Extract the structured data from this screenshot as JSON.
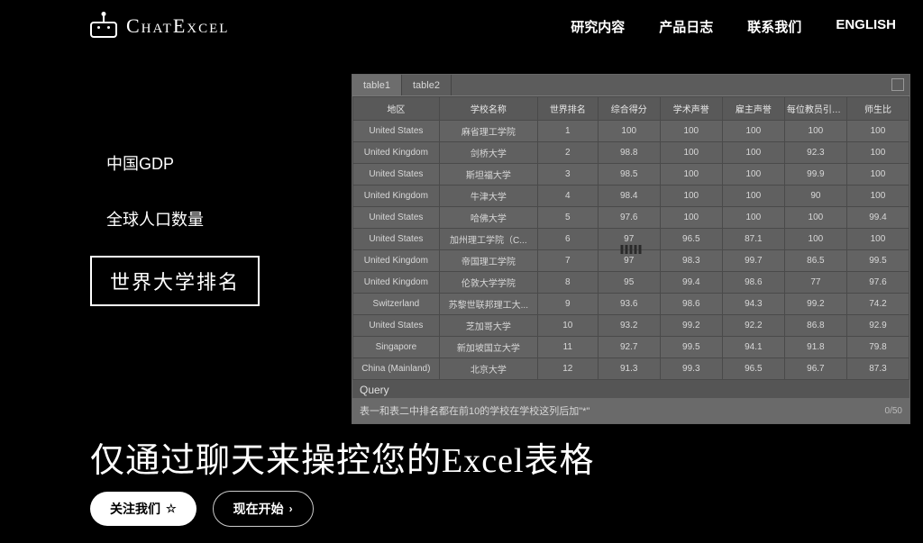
{
  "brand": "ChatExcel",
  "nav": {
    "research": "研究内容",
    "changelog": "产品日志",
    "contact": "联系我们",
    "lang": "ENGLISH"
  },
  "examples": {
    "items": [
      "中国GDP",
      "全球人口数量",
      "世界大学排名"
    ],
    "selected_index": 2
  },
  "panel": {
    "tabs": [
      "table1",
      "table2"
    ],
    "active_tab": 0,
    "expand_icon": "expand-icon",
    "columns": [
      "地区",
      "学校名称",
      "世界排名",
      "综合得分",
      "学术声誉",
      "雇主声誉",
      "每位教员引用率",
      "师生比"
    ],
    "rows": [
      [
        "United States",
        "麻省理工学院",
        "1",
        "100",
        "100",
        "100",
        "100",
        "100"
      ],
      [
        "United Kingdom",
        "剑桥大学",
        "2",
        "98.8",
        "100",
        "100",
        "92.3",
        "100"
      ],
      [
        "United States",
        "斯坦福大学",
        "3",
        "98.5",
        "100",
        "100",
        "99.9",
        "100"
      ],
      [
        "United Kingdom",
        "牛津大学",
        "4",
        "98.4",
        "100",
        "100",
        "90",
        "100"
      ],
      [
        "United States",
        "哈佛大学",
        "5",
        "97.6",
        "100",
        "100",
        "100",
        "99.4"
      ],
      [
        "United States",
        "加州理工学院（C...",
        "6",
        "97",
        "96.5",
        "87.1",
        "100",
        "100"
      ],
      [
        "United Kingdom",
        "帝国理工学院",
        "7",
        "97",
        "98.3",
        "99.7",
        "86.5",
        "99.5"
      ],
      [
        "United Kingdom",
        "伦敦大学学院",
        "8",
        "95",
        "99.4",
        "98.6",
        "77",
        "97.6"
      ],
      [
        "Switzerland",
        "苏黎世联邦理工大...",
        "9",
        "93.6",
        "98.6",
        "94.3",
        "99.2",
        "74.2"
      ],
      [
        "United States",
        "芝加哥大学",
        "10",
        "93.2",
        "99.2",
        "92.2",
        "86.8",
        "92.9"
      ],
      [
        "Singapore",
        "新加坡国立大学",
        "11",
        "92.7",
        "99.5",
        "94.1",
        "91.8",
        "79.8"
      ],
      [
        "China (Mainland)",
        "北京大学",
        "12",
        "91.3",
        "99.3",
        "96.5",
        "96.7",
        "87.3"
      ]
    ],
    "query": {
      "label": "Query",
      "text": "表一和表二中排名都在前10的学校在学校这列后加\"*\"",
      "counter": "0/50"
    }
  },
  "hero": "仅通过聊天来操控您的Excel表格",
  "cta": {
    "follow": "关注我们",
    "start": "现在开始"
  }
}
